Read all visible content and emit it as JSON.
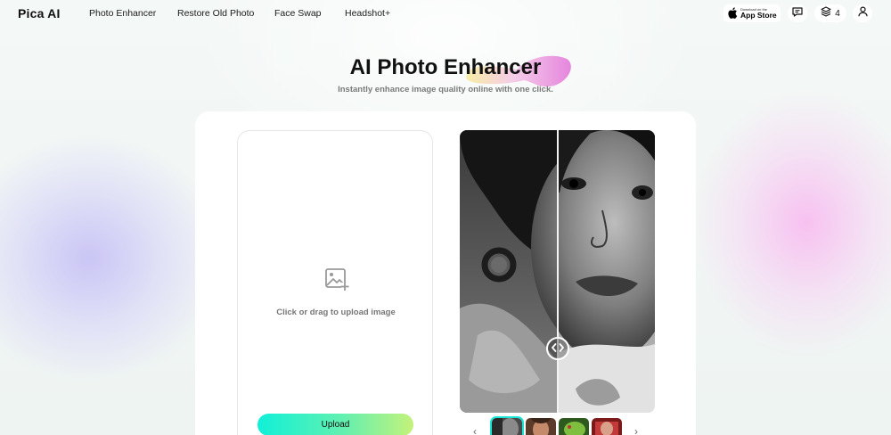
{
  "header": {
    "logo": "Pica AI",
    "nav": [
      "Photo Enhancer",
      "Restore Old Photo",
      "Face Swap",
      "Headshot+"
    ],
    "app_store": {
      "small": "Download on the",
      "big": "App Store"
    },
    "credits": "4"
  },
  "icons": {
    "apple": "apple-icon",
    "feedback": "chat-icon",
    "credits": "layers-icon",
    "user": "user-icon",
    "upload": "image-plus-icon",
    "prev": "chevron-left-icon",
    "next": "chevron-right-icon"
  },
  "colors": {
    "accent_start": "#10f0d8",
    "accent_end": "#c4f27a",
    "title_blob_pink": "#e88fe0",
    "title_blob_yellow": "#f4e79a"
  },
  "hero": {
    "title": "AI Photo Enhancer",
    "subtitle": "Instantly enhance image quality online with one click."
  },
  "upload": {
    "hint": "Click or drag to upload image",
    "button": "Upload"
  },
  "preview": {
    "thumbnails": [
      "sample-1",
      "sample-2",
      "sample-3",
      "sample-4"
    ],
    "active_thumbnail": 0
  }
}
